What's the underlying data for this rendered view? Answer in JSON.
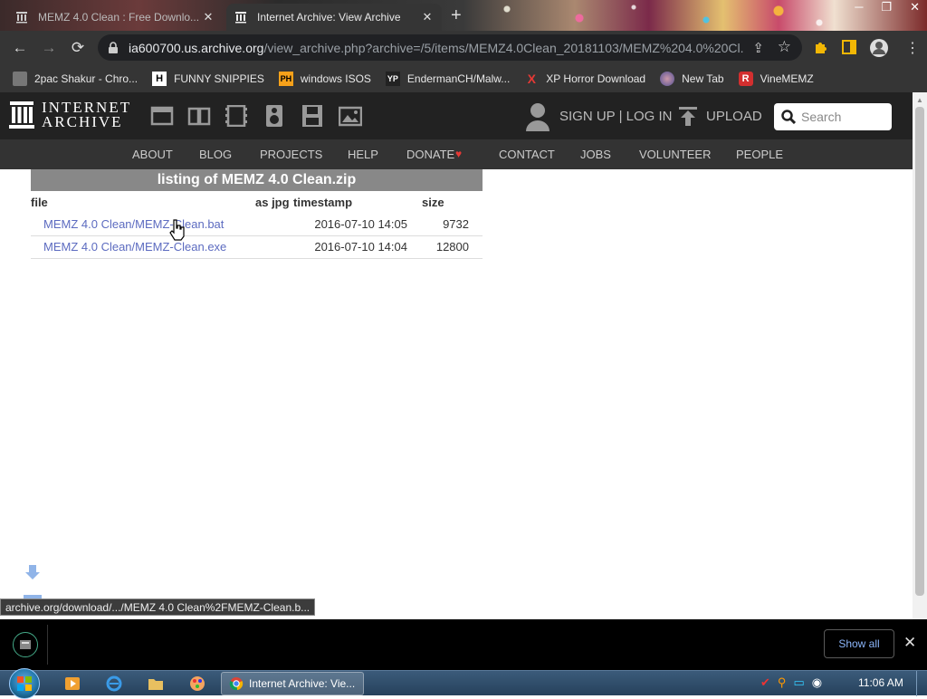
{
  "tabs": [
    {
      "title": "MEMZ 4.0 Clean : Free Downlo...",
      "active": false
    },
    {
      "title": "Internet Archive: View Archive",
      "active": true
    }
  ],
  "address_bar": {
    "host": "ia600700.us.archive.org",
    "path": "/view_archive.php?archive=/5/items/MEMZ4.0Clean_20181103/MEMZ%204.0%20Cl..."
  },
  "bookmarks": [
    {
      "label": "2pac Shakur - Chro...",
      "icon": "2pac-favicon"
    },
    {
      "label": "FUNNY SNIPPIES",
      "icon": "H"
    },
    {
      "label": "windows ISOS",
      "icon": "PH"
    },
    {
      "label": "EndermanCH/Malw...",
      "icon": "YP"
    },
    {
      "label": "XP Horror Download",
      "icon": "X"
    },
    {
      "label": "New Tab",
      "icon": "globe-favicon"
    },
    {
      "label": "VineMEMZ",
      "icon": "R"
    }
  ],
  "ia_header": {
    "logo_line1": "INTERNET",
    "logo_line2": "ARCHIVE",
    "signup_login": "SIGN UP | LOG IN",
    "upload": "UPLOAD",
    "search_placeholder": "Search"
  },
  "ia_nav": [
    "ABOUT",
    "BLOG",
    "PROJECTS",
    "HELP",
    "DONATE",
    "CONTACT",
    "JOBS",
    "VOLUNTEER",
    "PEOPLE"
  ],
  "listing": {
    "title": "listing of MEMZ 4.0 Clean.zip",
    "headers": {
      "file": "file",
      "as_jpg": "as jpg",
      "timestamp": "timestamp",
      "size": "size"
    },
    "rows": [
      {
        "file": "MEMZ 4.0 Clean/MEMZ-Clean.bat",
        "timestamp": "2016-07-10 14:05",
        "size": "9732"
      },
      {
        "file": "MEMZ 4.0 Clean/MEMZ-Clean.exe",
        "timestamp": "2016-07-10 14:04",
        "size": "12800"
      }
    ]
  },
  "status_url": "archive.org/download/.../MEMZ 4.0 Clean%2FMEMZ-Clean.b...",
  "download_shelf": {
    "show_all": "Show all"
  },
  "taskbar": {
    "chrome_window": "Internet Archive: Vie...",
    "clock": "11:06 AM"
  },
  "colors": {
    "ia_dark": "#222222",
    "ia_nav": "#333333",
    "link": "#5c6bc0",
    "donate_heart": "#e53935",
    "chrome_frame": "#353535"
  }
}
